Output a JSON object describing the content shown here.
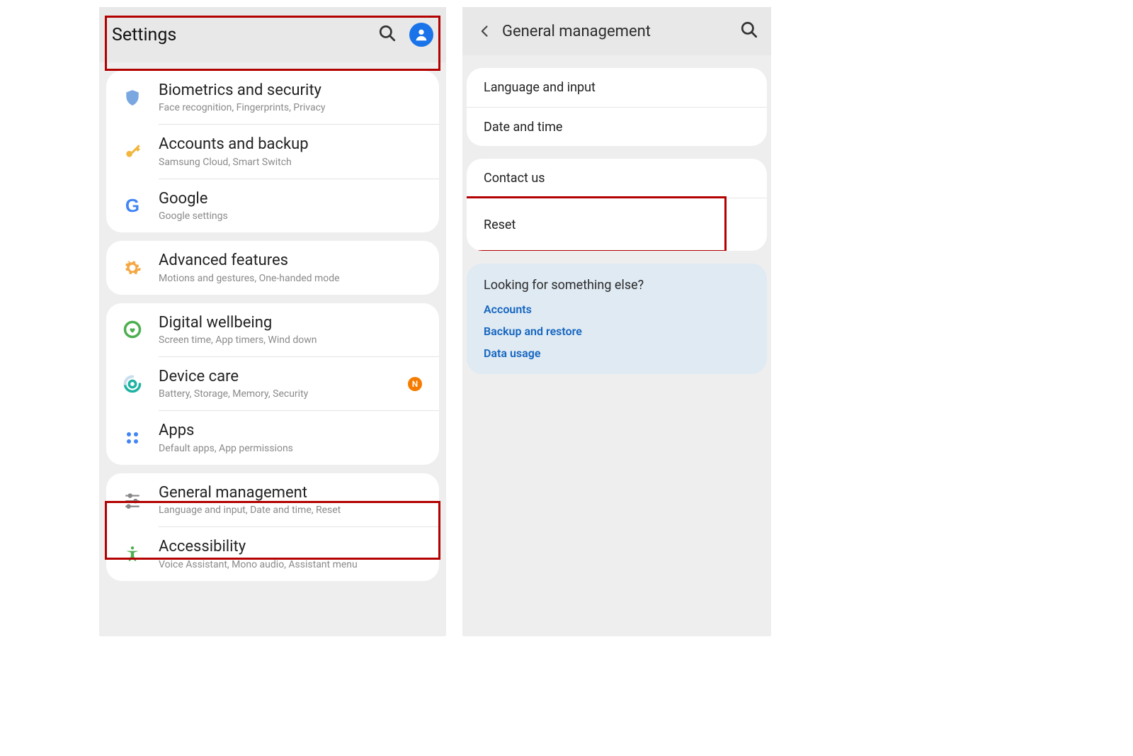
{
  "left": {
    "title": "Settings",
    "groups": [
      {
        "rows": [
          {
            "id": "biometrics",
            "label": "Biometrics and security",
            "sub": "Face recognition, Fingerprints, Privacy",
            "icon": "shield"
          },
          {
            "id": "accounts",
            "label": "Accounts and backup",
            "sub": "Samsung Cloud, Smart Switch",
            "icon": "key"
          },
          {
            "id": "google",
            "label": "Google",
            "sub": "Google settings",
            "icon": "google"
          }
        ]
      },
      {
        "rows": [
          {
            "id": "advanced",
            "label": "Advanced features",
            "sub": "Motions and gestures, One-handed mode",
            "icon": "gear"
          }
        ]
      },
      {
        "rows": [
          {
            "id": "wellbeing",
            "label": "Digital wellbeing",
            "sub": "Screen time, App timers, Wind down",
            "icon": "heart"
          },
          {
            "id": "devicecare",
            "label": "Device care",
            "sub": "Battery, Storage, Memory, Security",
            "icon": "care",
            "badge": "N"
          },
          {
            "id": "apps",
            "label": "Apps",
            "sub": "Default apps, App permissions",
            "icon": "grid"
          }
        ]
      },
      {
        "rows": [
          {
            "id": "general",
            "label": "General management",
            "sub": "Language and input, Date and time, Reset",
            "icon": "sliders"
          },
          {
            "id": "access",
            "label": "Accessibility",
            "sub": "Voice Assistant, Mono audio, Assistant menu",
            "icon": "access"
          }
        ]
      }
    ]
  },
  "right": {
    "title": "General management",
    "group1": [
      {
        "id": "lang",
        "label": "Language and input"
      },
      {
        "id": "date",
        "label": "Date and time"
      }
    ],
    "group2": [
      {
        "id": "contact",
        "label": "Contact us"
      },
      {
        "id": "reset",
        "label": "Reset"
      }
    ],
    "suggest": {
      "head": "Looking for something else?",
      "links": [
        "Accounts",
        "Backup and restore",
        "Data usage"
      ]
    }
  }
}
